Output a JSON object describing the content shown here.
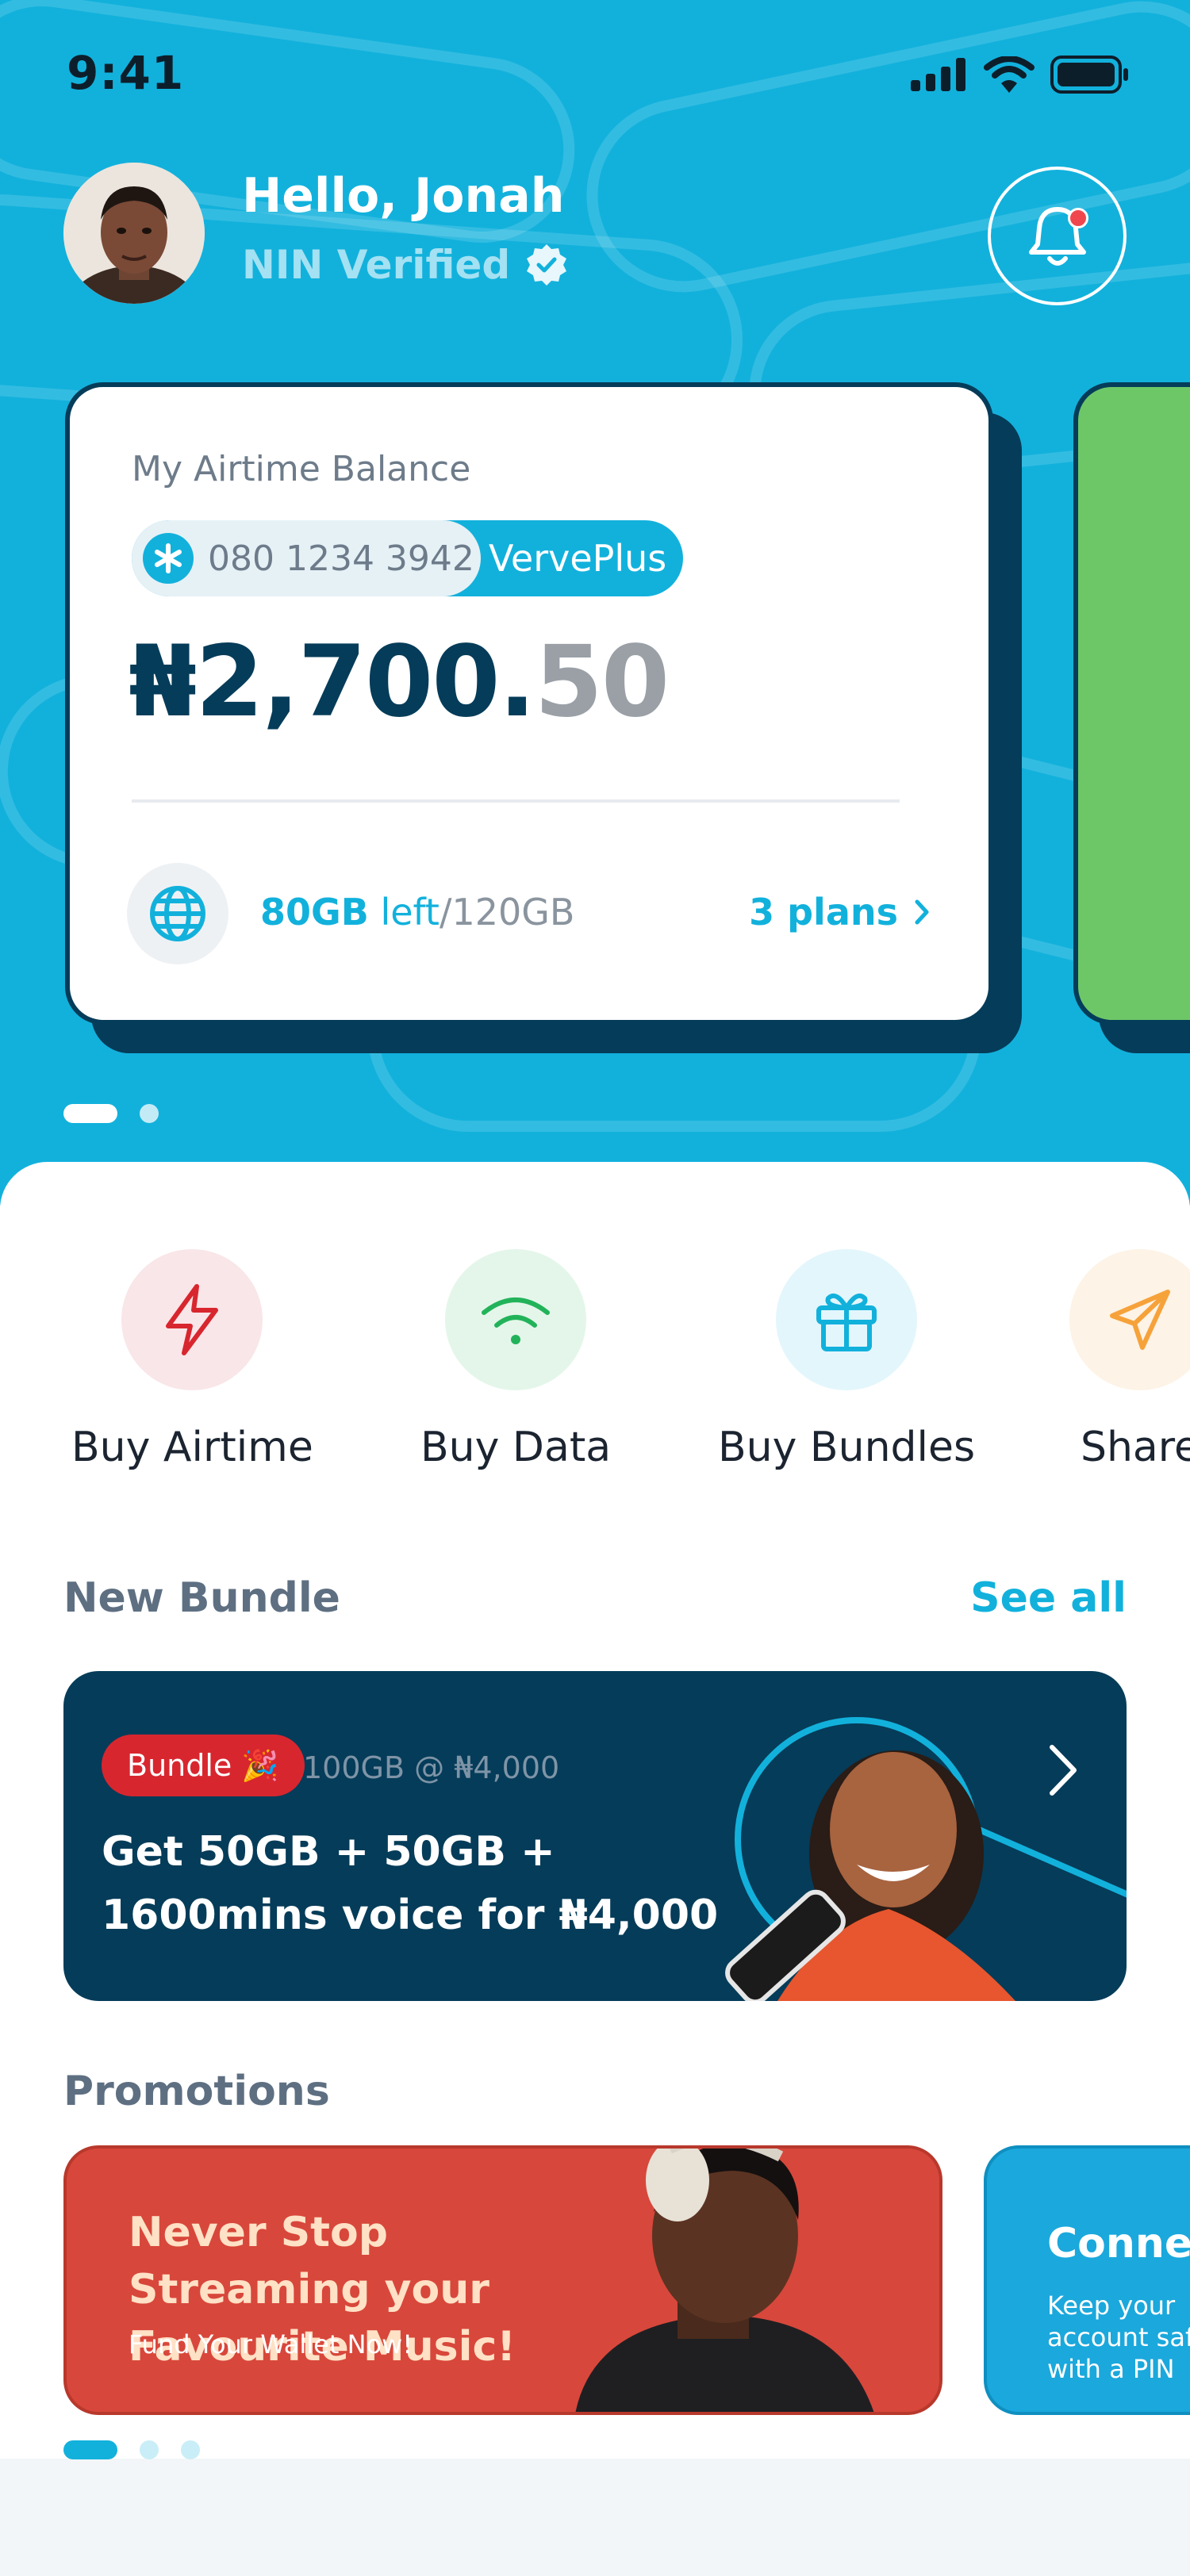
{
  "status_bar": {
    "time": "9:41"
  },
  "header": {
    "greeting": "Hello, Jonah",
    "verification": "NIN Verified"
  },
  "balance_card": {
    "label": "My Airtime Balance",
    "phone": "080 1234 3942",
    "plan": "VervePlus",
    "amount_main": "₦2,700.",
    "amount_decimal": "50",
    "data_used": "80GB",
    "data_left_word": " left",
    "data_total": "/120GB",
    "plans_link": "3 plans"
  },
  "actions": [
    {
      "label": "Buy Airtime",
      "icon": "lightning-icon"
    },
    {
      "label": "Buy Data",
      "icon": "wifi-icon"
    },
    {
      "label": "Buy Bundles",
      "icon": "gift-icon"
    },
    {
      "label": "Share",
      "icon": "send-icon"
    }
  ],
  "new_bundle": {
    "title": "New Bundle",
    "see_all": "See all",
    "tag": "Bundle 🎉",
    "price": "100GB @ ₦4,000",
    "description": "Get 50GB + 50GB + 1600mins voice for ₦4,000"
  },
  "promotions": {
    "title": "Promotions",
    "items": [
      {
        "headline": "Never Stop Streaming your Favourite Music!",
        "subtext": "Fund Your Wallet Now!"
      },
      {
        "headline": "Connect",
        "subtext": "Keep your account safe with a PIN"
      }
    ]
  },
  "colors": {
    "brand_blue": "#12b1dc",
    "navy": "#053c59",
    "green_card": "#6dc767",
    "promo_red": "#d8473b"
  }
}
